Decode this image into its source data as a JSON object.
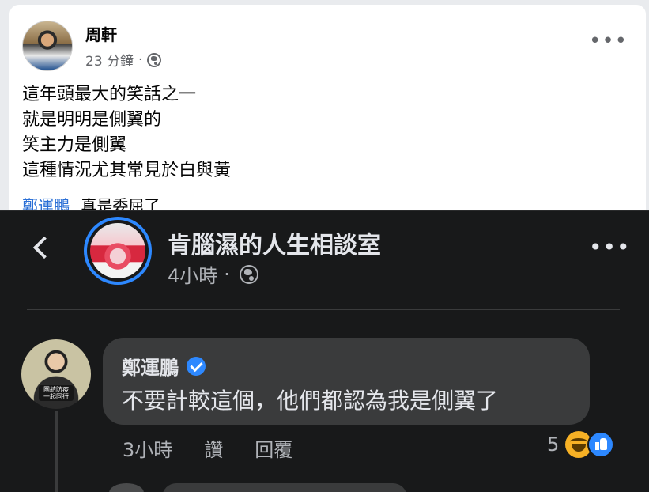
{
  "post": {
    "author": "周軒",
    "time": "23 分鐘",
    "separator": "·",
    "body_lines": [
      "這年頭最大的笑話之一",
      "就是明明是側翼的",
      "笑主力是側翼",
      "這種情況尤其常見於白與黃"
    ],
    "peek": {
      "mention": "鄭運鵬",
      "text": "真是委屈了"
    },
    "menu_label": "•••"
  },
  "screenshot": {
    "page_name": "肯腦濕的人生相談室",
    "time": "4小時",
    "separator": "·",
    "menu_label": "•••",
    "comment": {
      "author": "鄭運鵬",
      "text": "不要計較這個，他們都認為我是側翼了",
      "avatar_tag": "團結防疫 一起同行",
      "time": "3小時",
      "like_label": "讚",
      "reply_label": "回覆",
      "reaction_count": "5"
    }
  },
  "colors": {
    "link": "#2a6fd6",
    "verified": "#2d88ff",
    "haha": "#f7b125",
    "like": "#2d88ff",
    "dark_bg": "#18191a"
  }
}
